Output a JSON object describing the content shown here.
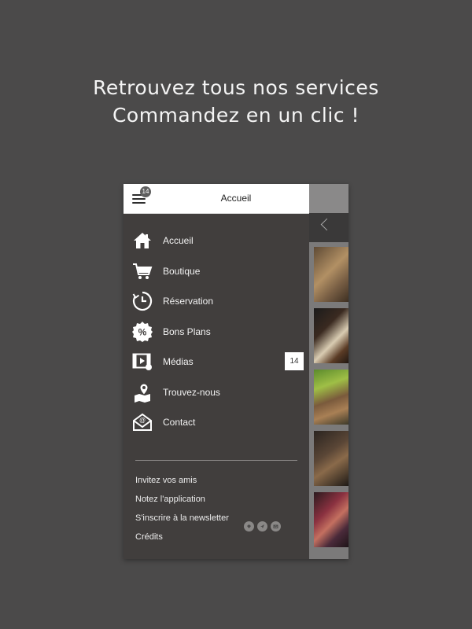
{
  "headline": {
    "line1": "Retrouvez tous nos services",
    "line2": "Commandez en un clic !"
  },
  "topbar": {
    "title": "Accueil",
    "menu_badge": "14"
  },
  "menu": {
    "items": [
      {
        "label": "Accueil",
        "icon": "home-icon"
      },
      {
        "label": "Boutique",
        "icon": "cart-icon"
      },
      {
        "label": "Réservation",
        "icon": "clock-icon"
      },
      {
        "label": "Bons Plans",
        "icon": "discount-badge-icon"
      },
      {
        "label": "Médias",
        "icon": "video-icon",
        "badge": "14"
      },
      {
        "label": "Trouvez-nous",
        "icon": "map-pin-icon"
      },
      {
        "label": "Contact",
        "icon": "envelope-icon"
      }
    ]
  },
  "footer": {
    "links": [
      "Invitez vos amis",
      "Notez l'application",
      "S'inscrire à la newsletter",
      "Crédits"
    ],
    "social_icons": [
      "social-icon-1",
      "social-icon-2",
      "social-icon-3"
    ]
  },
  "colors": {
    "background": "#4b4a4a",
    "drawer": "#413e3d",
    "topbar": "#ffffff",
    "text": "#f2f2f2"
  }
}
